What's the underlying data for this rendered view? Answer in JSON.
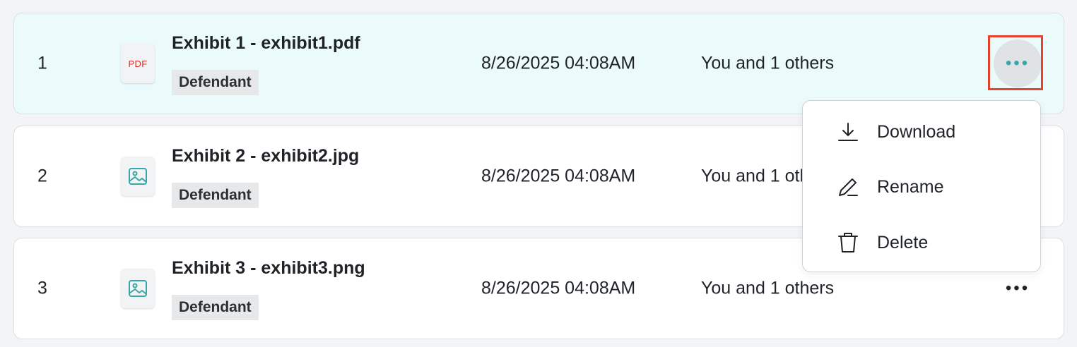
{
  "rows": [
    {
      "index": "1",
      "icon": "pdf-icon",
      "icon_text": "PDF",
      "title": "Exhibit 1 - exhibit1.pdf",
      "party": "Defendant",
      "date": "8/26/2025 04:08AM",
      "shared": "You and 1 others"
    },
    {
      "index": "2",
      "icon": "image-icon",
      "title": "Exhibit 2 - exhibit2.jpg",
      "party": "Defendant",
      "date": "8/26/2025 04:08AM",
      "shared": "You and 1 others"
    },
    {
      "index": "3",
      "icon": "image-icon",
      "title": "Exhibit 3 - exhibit3.png",
      "party": "Defendant",
      "date": "8/26/2025 04:08AM",
      "shared": "You and 1 others"
    }
  ],
  "more_label": "•••",
  "menu": {
    "items": [
      {
        "icon": "download-icon",
        "label": "Download"
      },
      {
        "icon": "pencil-icon",
        "label": "Rename"
      },
      {
        "icon": "trash-icon",
        "label": "Delete"
      }
    ]
  },
  "colors": {
    "active_row": "#ebfbfc",
    "highlight": "#e8412c",
    "accent": "#3aa6a6",
    "pdf": "#d93025"
  }
}
